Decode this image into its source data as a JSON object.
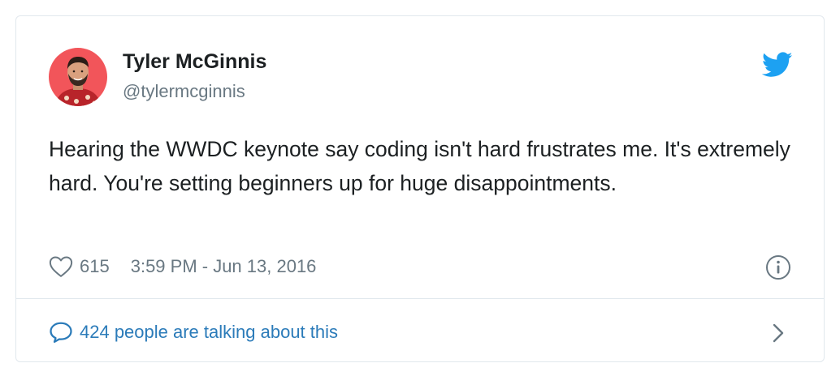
{
  "author": {
    "name": "Tyler McGinnis",
    "handle": "@tylermcginnis",
    "avatar_icon": "avatar-photo"
  },
  "tweet": {
    "text": "Hearing the WWDC keynote say coding isn't hard frustrates me. It's extremely hard. You're setting beginners up for huge disappointments."
  },
  "meta": {
    "likes": "615",
    "timestamp": "3:59 PM - Jun 13, 2016",
    "like_icon": "heart-icon",
    "info_icon": "info-icon"
  },
  "footer": {
    "talking_label": "424 people are talking about this",
    "bubble_icon": "speech-bubble-icon",
    "chevron_icon": "chevron-right-icon"
  },
  "colors": {
    "twitter_blue": "#1da1f2",
    "link_blue": "#2b7bb9",
    "muted_text": "#697882",
    "border": "#e1e8ed",
    "avatar_bg": "#f2555a"
  }
}
